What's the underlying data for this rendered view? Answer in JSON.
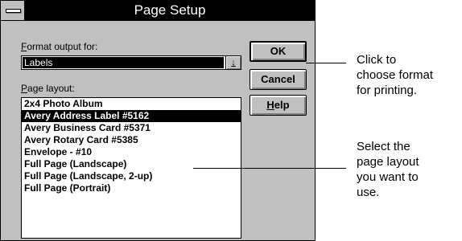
{
  "dialog": {
    "title": "Page Setup",
    "format_label_first": "F",
    "format_label_rest": "ormat output for:",
    "format_value": "Labels",
    "dropdown_arrow": "↓",
    "layout_label_first": "P",
    "layout_label_rest": "age layout:",
    "layouts": [
      "2x4 Photo Album",
      "Avery Address Label #5162",
      "Avery Business Card #5371",
      "Avery Rotary Card #5385",
      "Envelope - #10",
      "Full Page (Landscape)",
      "Full Page (Landscape, 2-up)",
      "Full Page (Portrait)"
    ],
    "selected_index": 1,
    "buttons": {
      "ok": "OK",
      "cancel": "Cancel",
      "help_first": "H",
      "help_rest": "elp"
    }
  },
  "callouts": {
    "format": [
      "Click to",
      "choose format",
      "for printing."
    ],
    "layout": [
      "Select the",
      "page layout",
      "you want to",
      "use."
    ]
  }
}
